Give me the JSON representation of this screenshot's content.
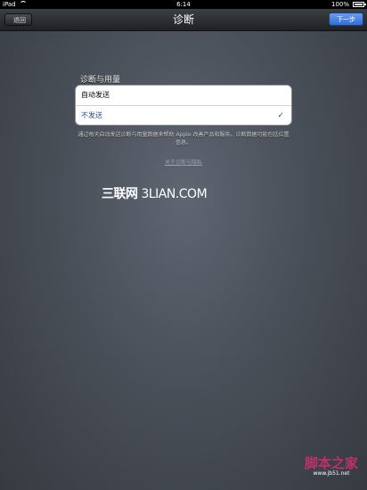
{
  "status_bar": {
    "device": "iPad",
    "time": "6:14",
    "battery": "100%"
  },
  "nav": {
    "title": "诊断",
    "back_label": "退回",
    "next_label": "下一步"
  },
  "section": {
    "header": "诊断与用量",
    "options": [
      {
        "label": "自动发送",
        "selected": false
      },
      {
        "label": "不发送",
        "selected": true
      }
    ],
    "footer": "通过每天自动发送诊断与用量数据来帮助 Apple 改善产品和服务。诊断数据可能包括位置信息。",
    "about_link": "关于诊断与隐私"
  },
  "watermark": {
    "cn": "三联网",
    "en": " 3LIAN.COM"
  },
  "corner_logo": {
    "main": "脚本之家",
    "sub": "www.jb51.net"
  },
  "colors": {
    "accent": "#2f6ed6",
    "check": "#2a4e86"
  }
}
